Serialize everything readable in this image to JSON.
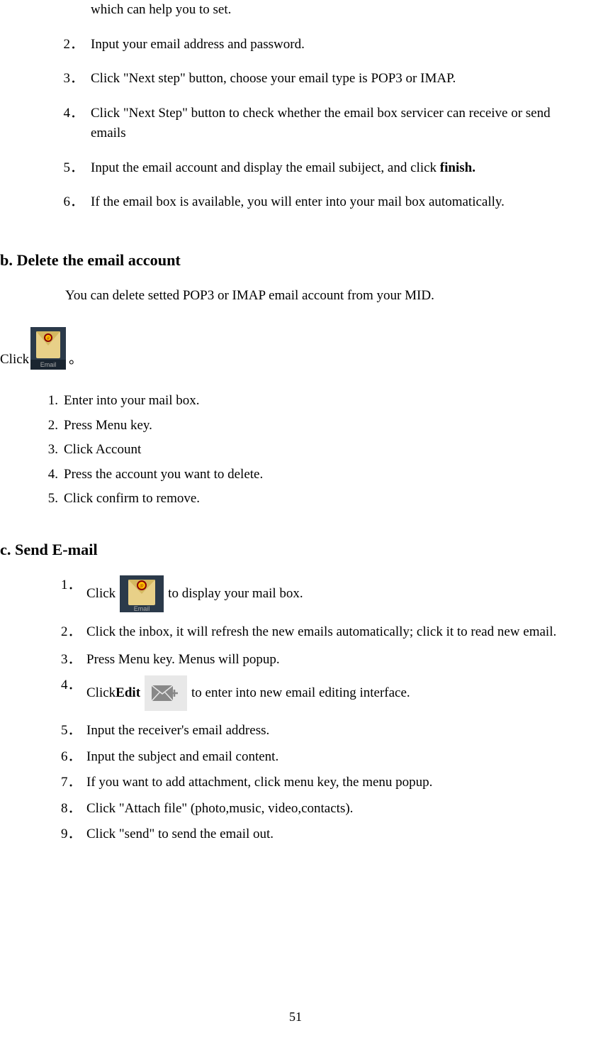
{
  "sectionA": {
    "items": [
      {
        "num": "",
        "text": "which can help you to set."
      },
      {
        "num": "2．",
        "text": "Input your email address and password."
      },
      {
        "num": "3．",
        "text": "Click \"Next step\" button, choose your email type is POP3 or IMAP."
      },
      {
        "num": "4．",
        "text": "Click \"Next Step\" button to check whether the email box servicer can receive or send emails"
      },
      {
        "num": "5．",
        "text_pre": "Input the email account and display the email subiject, and click ",
        "bold": "finish."
      },
      {
        "num": "6．",
        "text": "If the email box is available, you will enter into your mail box automatically."
      }
    ]
  },
  "sectionB": {
    "heading": "b. Delete the email account",
    "intro": "You can delete setted POP3 or IMAP email account from your MID.",
    "click_pre": "Click",
    "click_post": "。",
    "items": [
      {
        "num": "1.",
        "text": "Enter into your mail box."
      },
      {
        "num": "2.",
        "text": "Press Menu key."
      },
      {
        "num": "3.",
        "text": "Click Account"
      },
      {
        "num": "4.",
        "text": "Press the account you want to delete."
      },
      {
        "num": "5.",
        "text": "Click confirm to remove."
      }
    ]
  },
  "sectionC": {
    "heading": "c. Send E-mail",
    "items": [
      {
        "num": "1．",
        "pre": "Click ",
        "post": " to display your mail box.",
        "icon": "email"
      },
      {
        "num": "2．",
        "text": "Click the inbox, it will refresh the new emails automatically; click it to read new email."
      },
      {
        "num": "3．",
        "text": "Press Menu key. Menus will popup."
      },
      {
        "num": "4．",
        "pre": "Click ",
        "bold": "Edit",
        "post": " to enter into new email editing interface.",
        "icon": "compose"
      },
      {
        "num": "5．",
        "text": "Input the receiver's email address."
      },
      {
        "num": "6．",
        "text": "Input the subject and email content."
      },
      {
        "num": "7．",
        "text": "If you want to add attachment, click menu key, the menu popup."
      },
      {
        "num": "8．",
        "text": "Click \"Attach file\" (photo,music, video,contacts)."
      },
      {
        "num": "9．",
        "text": "Click \"send\" to send the email out."
      }
    ]
  },
  "pageNumber": "51",
  "icons": {
    "email_label": "Email"
  }
}
